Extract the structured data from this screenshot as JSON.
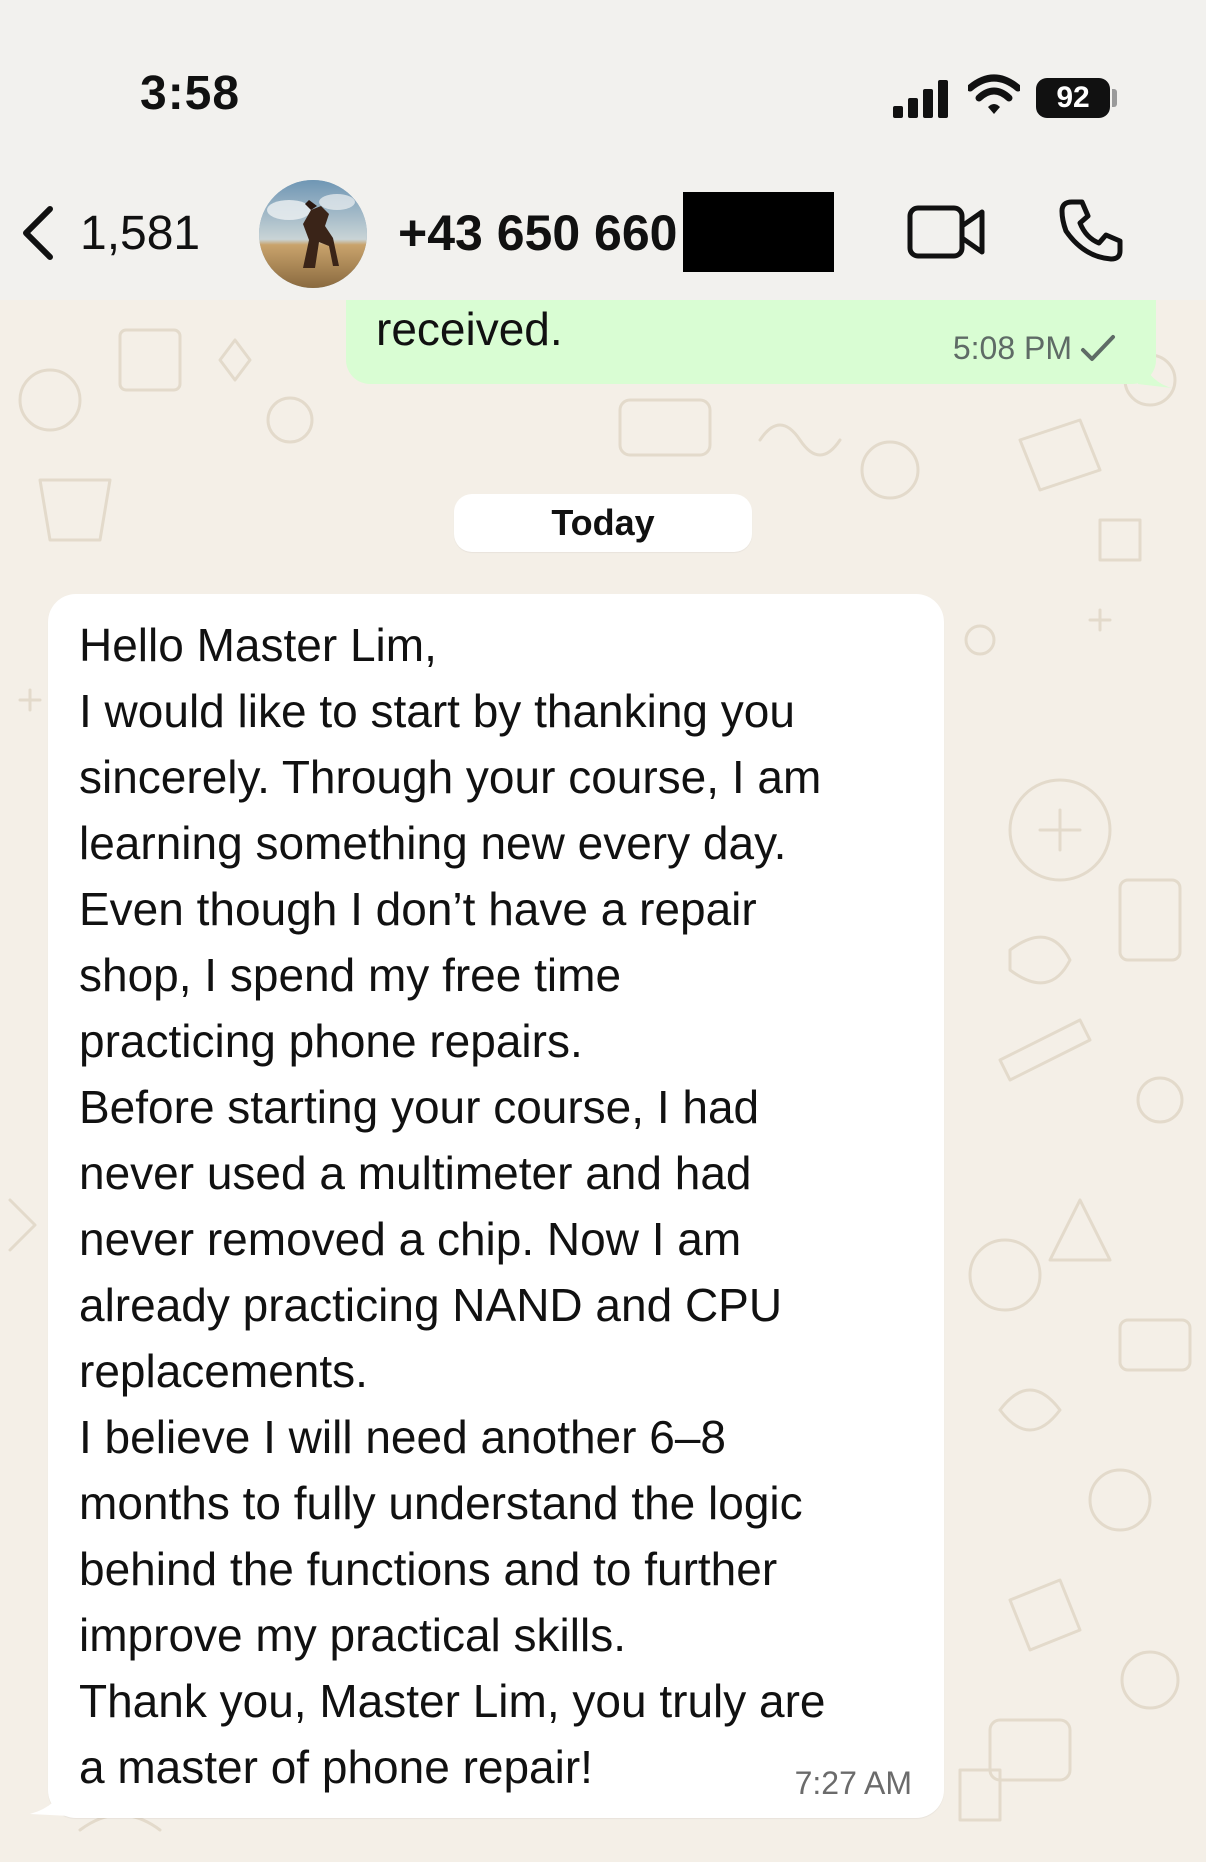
{
  "status_bar": {
    "time": "3:58",
    "battery_level": "92",
    "icons": [
      "signal-icon",
      "wifi-icon",
      "battery-icon"
    ]
  },
  "header": {
    "back_count": "1,581",
    "contact_name": "+43 650 660",
    "icons": [
      "back-chevron-icon",
      "avatar-horse",
      "video-call-icon",
      "phone-icon"
    ]
  },
  "messages": {
    "outgoing": {
      "text": "received.",
      "time": "5:08 PM",
      "status_icon": "check-icon"
    },
    "date_separator": "Today",
    "incoming": {
      "lines": [
        "Hello Master Lim,",
        "I would like to start by thanking you",
        "sincerely. Through your course, I am",
        "learning something new every day.",
        "Even though I don’t have a repair",
        "shop, I spend my free time",
        "practicing phone repairs.",
        "Before starting your course, I had",
        "never used a multimeter and had",
        "never removed a chip. Now I am",
        "already practicing NAND and CPU",
        "replacements.",
        "I believe I will need another 6–8",
        "months to fully understand the logic",
        "behind the functions and to further",
        "improve my practical skills.",
        "Thank you, Master Lim, you truly are",
        "a master of phone repair!"
      ],
      "time": "7:27 AM"
    }
  },
  "colors": {
    "chat_background": "#f4efe7",
    "outgoing_bubble": "#d9fdd3",
    "incoming_bubble": "#ffffff",
    "bar_background": "#f2f1ee"
  }
}
